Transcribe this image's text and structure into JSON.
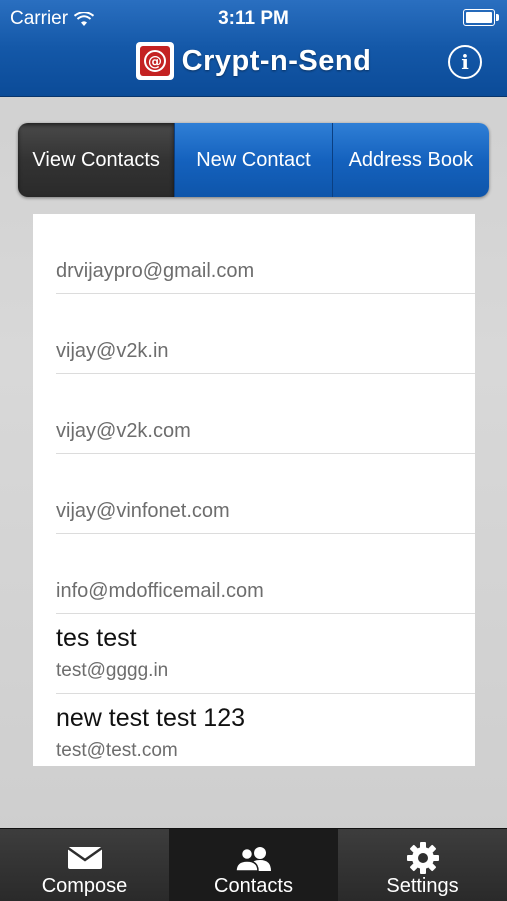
{
  "status_bar": {
    "carrier": "Carrier",
    "time": "3:11 PM"
  },
  "header": {
    "title": "Crypt-n-Send"
  },
  "segments": [
    {
      "label": "View Contacts",
      "active": true
    },
    {
      "label": "New Contact",
      "active": false
    },
    {
      "label": "Address Book",
      "active": false
    }
  ],
  "contacts": [
    {
      "name": "",
      "email": "drvijaypro@gmail.com"
    },
    {
      "name": "",
      "email": "vijay@v2k.in"
    },
    {
      "name": "",
      "email": "vijay@v2k.com"
    },
    {
      "name": "",
      "email": "vijay@vinfonet.com"
    },
    {
      "name": "",
      "email": "info@mdofficemail.com"
    },
    {
      "name": "tes test",
      "email": "test@gggg.in"
    },
    {
      "name": "new test test 123",
      "email": "test@test.com"
    }
  ],
  "tabbar": [
    {
      "label": "Compose",
      "icon": "envelope-icon",
      "active": false
    },
    {
      "label": "Contacts",
      "icon": "contacts-icon",
      "active": true
    },
    {
      "label": "Settings",
      "icon": "gear-icon",
      "active": false
    }
  ],
  "colors": {
    "nav_blue": "#1458a8",
    "segment_active": "#333333",
    "logo_red": "#c42222"
  }
}
